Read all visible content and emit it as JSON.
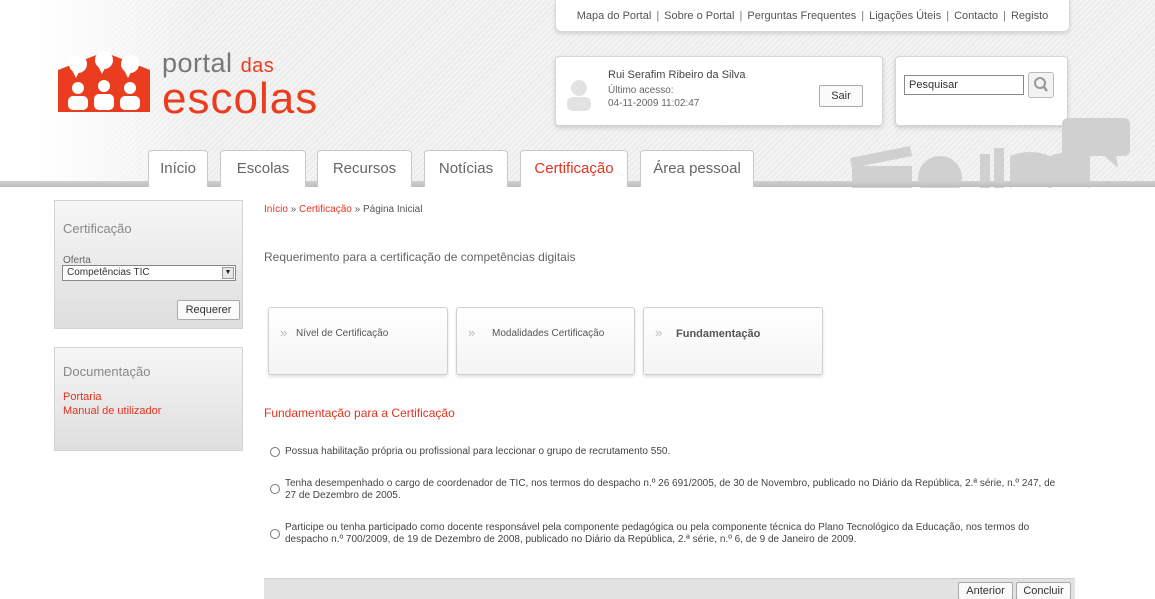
{
  "header": {
    "top_links": [
      "Mapa do Portal",
      "Sobre o Portal",
      "Perguntas Frequentes",
      "Ligações Úteis",
      "Contacto",
      "Registo"
    ],
    "logo": {
      "line1_main": "portal",
      "line1_das": "das",
      "line2": "escolas"
    },
    "user": {
      "name": "Rui Serafim Ribeiro da Silva",
      "last_access_label": "Último acesso:",
      "last_access_date": "04-11-2009 11:02:47",
      "logout_label": "Sair"
    },
    "search": {
      "value": "Pesquisar",
      "icon": "search-icon"
    },
    "tabs": [
      {
        "label": "Início",
        "active": false
      },
      {
        "label": "Escolas",
        "active": false
      },
      {
        "label": "Recursos",
        "active": false
      },
      {
        "label": "Notícias",
        "active": false
      },
      {
        "label": "Certificação",
        "active": true
      },
      {
        "label": "Área pessoal",
        "active": false
      }
    ]
  },
  "sidebar": {
    "certificacao": {
      "title": "Certificação",
      "oferta_label": "Oferta",
      "oferta_selected": "Competências TIC",
      "requerer_label": "Requerer"
    },
    "documentacao": {
      "title": "Documentação",
      "links": [
        "Portaria",
        "Manual de utilizador"
      ]
    }
  },
  "main": {
    "breadcrumb": {
      "home": "Início",
      "sep1": " » ",
      "section": "Certificação",
      "sep2": " » ",
      "current": "Página Inicial"
    },
    "subtitle": "Requerimento para a certificação de competências digitais",
    "steps": [
      {
        "label": "Nível de Certificação",
        "active": false
      },
      {
        "label": "Modalidades Certificação",
        "active": false
      },
      {
        "label": "Fundamentação",
        "active": true
      }
    ],
    "section_title": "Fundamentação para a Certificação",
    "options": [
      {
        "text": "Possua habilitação própria ou profissional para leccionar o grupo de recrutamento 550."
      },
      {
        "text": "Tenha desempenhado o cargo de coordenador de TIC, nos termos do despacho n.º 26 691/2005, de 30 de Novembro, publicado no Diário da República, 2.ª série, n.º 247, de 27 de Dezembro de 2005."
      },
      {
        "text": "Participe ou tenha participado como docente responsável pela componente pedagógica ou pela componente técnica do Plano Tecnológico da Educação, nos termos do despacho n.º 700/2009, de 19 de Dezembro de 2008, publicado no Diário da República, 2.ª série, n.º 6, de 9 de Janeiro de 2009."
      }
    ],
    "actions": {
      "previous_label": "Anterior",
      "finish_label": "Concluir"
    }
  },
  "colors": {
    "accent": "#e6321e",
    "logo_orange": "#ea3d1f"
  }
}
